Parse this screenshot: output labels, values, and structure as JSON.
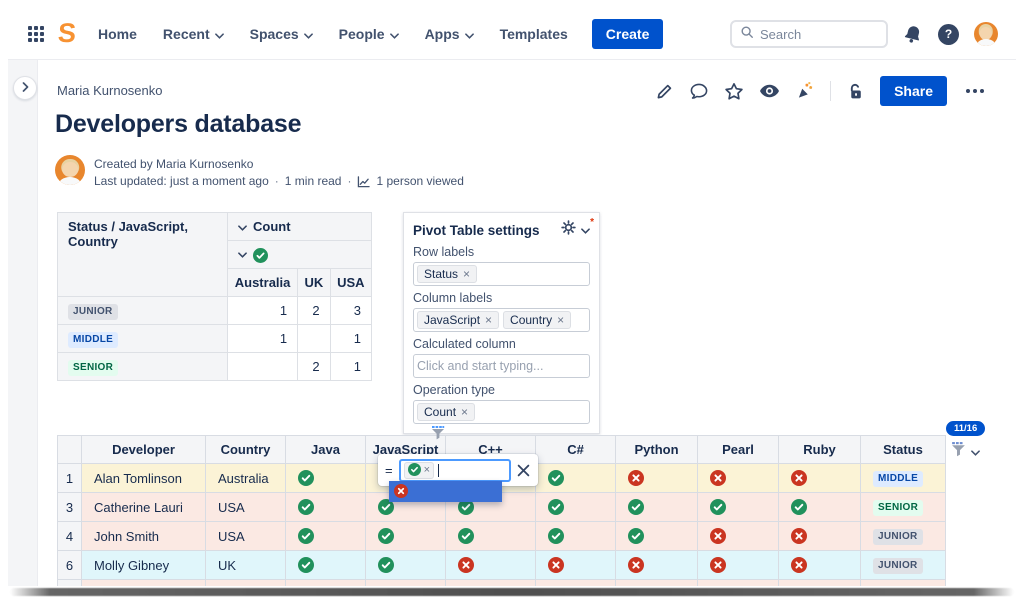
{
  "topnav": {
    "logo_letter": "S",
    "items": [
      {
        "label": "Home",
        "chevron": false
      },
      {
        "label": "Recent",
        "chevron": true
      },
      {
        "label": "Spaces",
        "chevron": true
      },
      {
        "label": "People",
        "chevron": true
      },
      {
        "label": "Apps",
        "chevron": true
      },
      {
        "label": "Templates",
        "chevron": false
      }
    ],
    "create_label": "Create",
    "search_placeholder": "Search"
  },
  "page_toolbar": {
    "breadcrumb": "Maria Kurnosenko",
    "share_label": "Share"
  },
  "page": {
    "title": "Developers database",
    "created_by": "Created by Maria Kurnosenko",
    "last_updated": "Last updated: just a moment ago",
    "read_time": "1 min read",
    "viewed": "1 person viewed",
    "dot": "·"
  },
  "pivot_table": {
    "corner_header": "Status / JavaScript, Country",
    "value_header": "Count",
    "value_filter_icon": "check",
    "columns": [
      "Australia",
      "UK",
      "USA"
    ],
    "rows": [
      {
        "label": "JUNIOR",
        "variant": "junior",
        "values": [
          "1",
          "2",
          "3"
        ]
      },
      {
        "label": "MIDDLE",
        "variant": "middle",
        "values": [
          "1",
          "",
          "1"
        ]
      },
      {
        "label": "SENIOR",
        "variant": "senior",
        "values": [
          "",
          "2",
          "1"
        ]
      }
    ]
  },
  "pivot_settings": {
    "title": "Pivot Table settings",
    "row_labels": {
      "label": "Row labels",
      "tags": [
        "Status"
      ]
    },
    "column_labels": {
      "label": "Column labels",
      "tags": [
        "JavaScript",
        "Country"
      ]
    },
    "calculated_column": {
      "label": "Calculated column",
      "placeholder": "Click and start typing..."
    },
    "operation_type": {
      "label": "Operation type",
      "tags": [
        "Count"
      ]
    }
  },
  "dev_table": {
    "filter_count_badge": "11/16",
    "filtered_column": "JavaScript",
    "columns": [
      "",
      "Developer",
      "Country",
      "Java",
      "JavaScript",
      "C++",
      "C#",
      "Python",
      "Pearl",
      "Ruby",
      "Status"
    ],
    "rows": [
      {
        "num": "1",
        "developer": "Alan Tomlinson",
        "country": "Australia",
        "row_tint": "yellow",
        "skills": {
          "Java": "check",
          "JavaScript": "",
          "C++": "",
          "C#": "check",
          "Python": "cross",
          "Pearl": "cross",
          "Ruby": "cross"
        },
        "status": {
          "label": "MIDDLE",
          "variant": "middle"
        }
      },
      {
        "num": "3",
        "developer": "Catherine Lauri",
        "country": "USA",
        "row_tint": "red",
        "skills": {
          "Java": "check",
          "JavaScript": "check",
          "C++": "check",
          "C#": "check",
          "Python": "check",
          "Pearl": "check",
          "Ruby": "check"
        },
        "status": {
          "label": "SENIOR",
          "variant": "senior"
        }
      },
      {
        "num": "4",
        "developer": "John Smith",
        "country": "USA",
        "row_tint": "red",
        "skills": {
          "Java": "check",
          "JavaScript": "check",
          "C++": "check",
          "C#": "check",
          "Python": "check",
          "Pearl": "cross",
          "Ruby": "cross"
        },
        "status": {
          "label": "JUNIOR",
          "variant": "junior"
        }
      },
      {
        "num": "6",
        "developer": "Molly Gibney",
        "country": "UK",
        "row_tint": "cyan",
        "skills": {
          "Java": "check",
          "JavaScript": "check",
          "C++": "cross",
          "C#": "cross",
          "Python": "cross",
          "Pearl": "cross",
          "Ruby": "cross"
        },
        "status": {
          "label": "JUNIOR",
          "variant": "junior"
        }
      }
    ],
    "partial_row_tint": "red"
  },
  "filter_popup": {
    "operator": "=",
    "selected_tag_icon": "check",
    "option_icon": "cross"
  },
  "colors": {
    "brand_blue": "#0052CC",
    "logo_orange": "#F79232",
    "check_green": "#21915C",
    "cross_red": "#CA3521",
    "row_yellow": "#FBF3D6",
    "row_red": "#FBE9E3",
    "row_cyan": "#E0F6FB",
    "badge_junior_bg": "#DFE1E6",
    "badge_middle_bg": "#DEEBFF",
    "badge_senior_bg": "#E3FCEF",
    "dropdown_highlight": "#3B6FD4"
  }
}
